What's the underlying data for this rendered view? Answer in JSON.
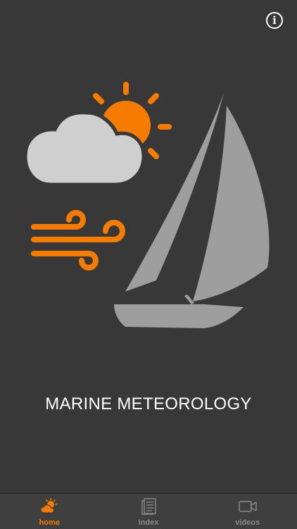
{
  "header": {
    "info_label": "i"
  },
  "main": {
    "title": "MARINE METEOROLOGY"
  },
  "tabs": [
    {
      "label": "home",
      "icon": "weather-sun-cloud-icon",
      "active": true
    },
    {
      "label": "index",
      "icon": "document-index-icon",
      "active": false
    },
    {
      "label": "videos",
      "icon": "video-camera-icon",
      "active": false
    }
  ],
  "colors": {
    "background": "#383838",
    "accent": "#f57c00",
    "cloud": "#cfcfcf",
    "sail": "#9e9e9e",
    "tab_bar": "#3f3f3f",
    "tab_inactive": "#8a8a8a"
  }
}
